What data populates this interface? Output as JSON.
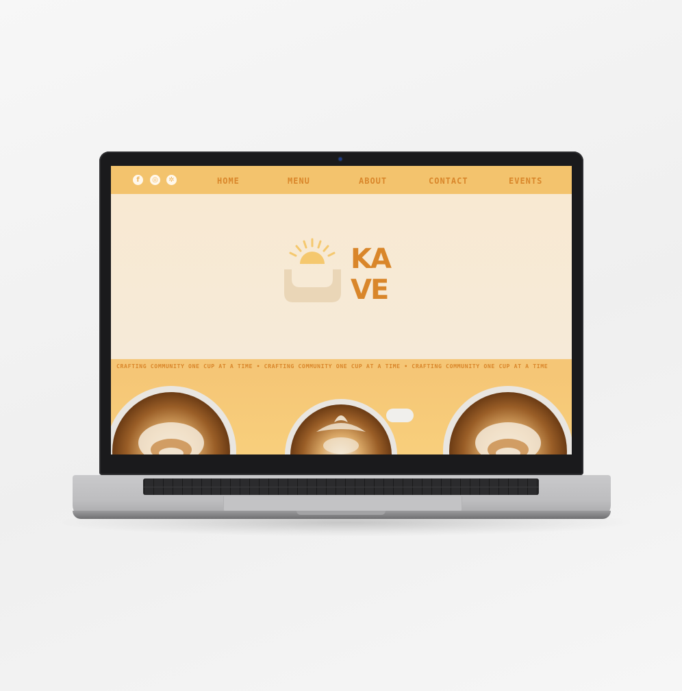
{
  "nav": {
    "social_icons": [
      {
        "name": "facebook-icon",
        "glyph": "f"
      },
      {
        "name": "instagram-icon",
        "glyph": "◎"
      },
      {
        "name": "yelp-icon",
        "glyph": "✲"
      }
    ],
    "links": [
      "HOME",
      "MENU",
      "ABOUT",
      "CONTACT",
      "EVENTS"
    ]
  },
  "logo": {
    "text_line1": "KA",
    "text_line2": "VE"
  },
  "ticker": {
    "text": "CRAFTING COMMUNITY ONE CUP AT A TIME • CRAFTING COMMUNITY ONE CUP AT A TIME • CRAFTING COMMUNITY ONE CUP AT A TIME"
  },
  "colors": {
    "accent": "#d9862a",
    "nav_bg": "#f3c36d",
    "hero_bg": "#f8e9d2",
    "sun": "#f5c86e",
    "cup_bowl": "#ead6b7",
    "coffee": "#8a5523",
    "foam": "#f2e4cc"
  }
}
